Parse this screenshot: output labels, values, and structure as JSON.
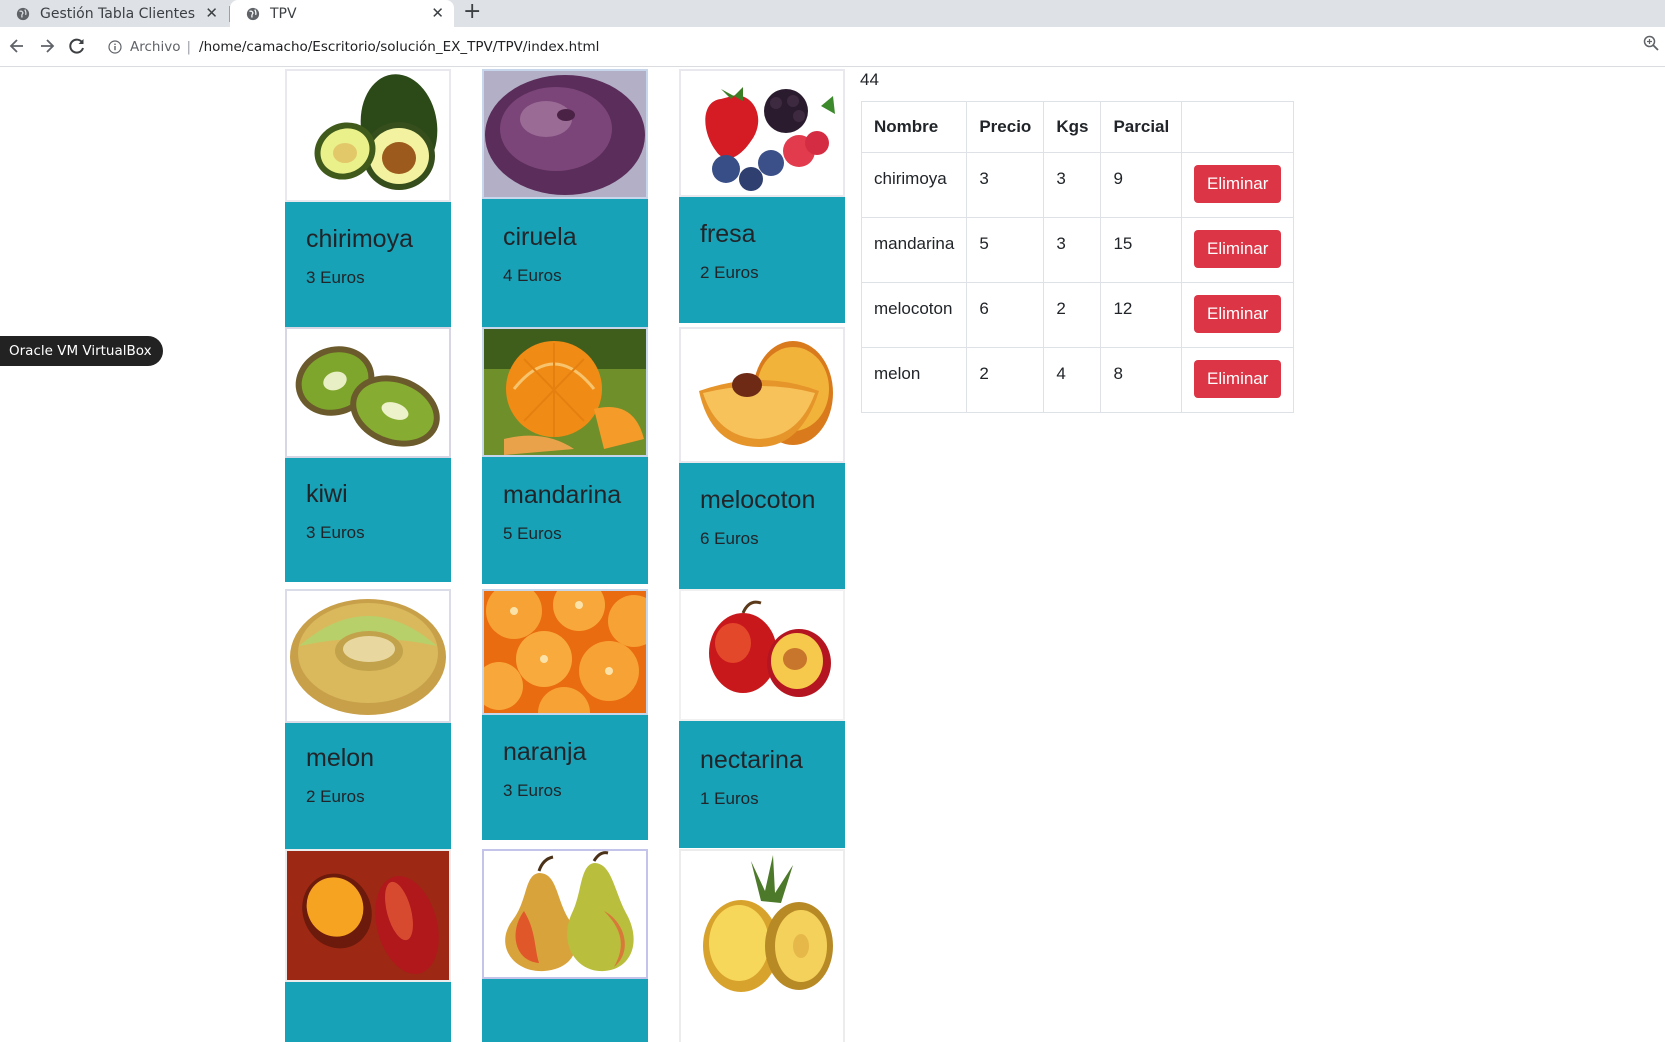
{
  "browser": {
    "tabs": [
      {
        "title": "Gestión Tabla Clientes",
        "active": false
      },
      {
        "title": "TPV",
        "active": true
      }
    ],
    "address": {
      "security_label": "Archivo",
      "url": "/home/camacho/Escritorio/solución_EX_TPV/TPV/index.html"
    }
  },
  "tooltip": "Oracle VM VirtualBox",
  "products": [
    {
      "name": "chirimoya",
      "price": "3 Euros",
      "image": "avocado"
    },
    {
      "name": "ciruela",
      "price": "4 Euros",
      "image": "plum"
    },
    {
      "name": "fresa",
      "price": "2 Euros",
      "image": "berries"
    },
    {
      "name": "kiwi",
      "price": "3 Euros",
      "image": "kiwi"
    },
    {
      "name": "mandarina",
      "price": "5 Euros",
      "image": "mandarin"
    },
    {
      "name": "melocoton",
      "price": "6 Euros",
      "image": "peach"
    },
    {
      "name": "melon",
      "price": "2 Euros",
      "image": "melon"
    },
    {
      "name": "naranja",
      "price": "3 Euros",
      "image": "orange-slices"
    },
    {
      "name": "nectarina",
      "price": "1 Euros",
      "image": "nectarine"
    },
    {
      "name": "",
      "price": "",
      "image": "mango"
    },
    {
      "name": "",
      "price": "",
      "image": "pear"
    },
    {
      "name": "",
      "price": "",
      "image": "pineapple"
    }
  ],
  "cart": {
    "total": "44",
    "headers": [
      "Nombre",
      "Precio",
      "Kgs",
      "Parcial",
      ""
    ],
    "rows": [
      {
        "nombre": "chirimoya",
        "precio": "3",
        "kgs": "3",
        "parcial": "9",
        "action": "Eliminar"
      },
      {
        "nombre": "mandarina",
        "precio": "5",
        "kgs": "3",
        "parcial": "15",
        "action": "Eliminar"
      },
      {
        "nombre": "melocoton",
        "precio": "6",
        "kgs": "2",
        "parcial": "12",
        "action": "Eliminar"
      },
      {
        "nombre": "melon",
        "precio": "2",
        "kgs": "4",
        "parcial": "8",
        "action": "Eliminar"
      }
    ]
  },
  "colors": {
    "card": "#17a2b8",
    "danger": "#dc3545"
  }
}
